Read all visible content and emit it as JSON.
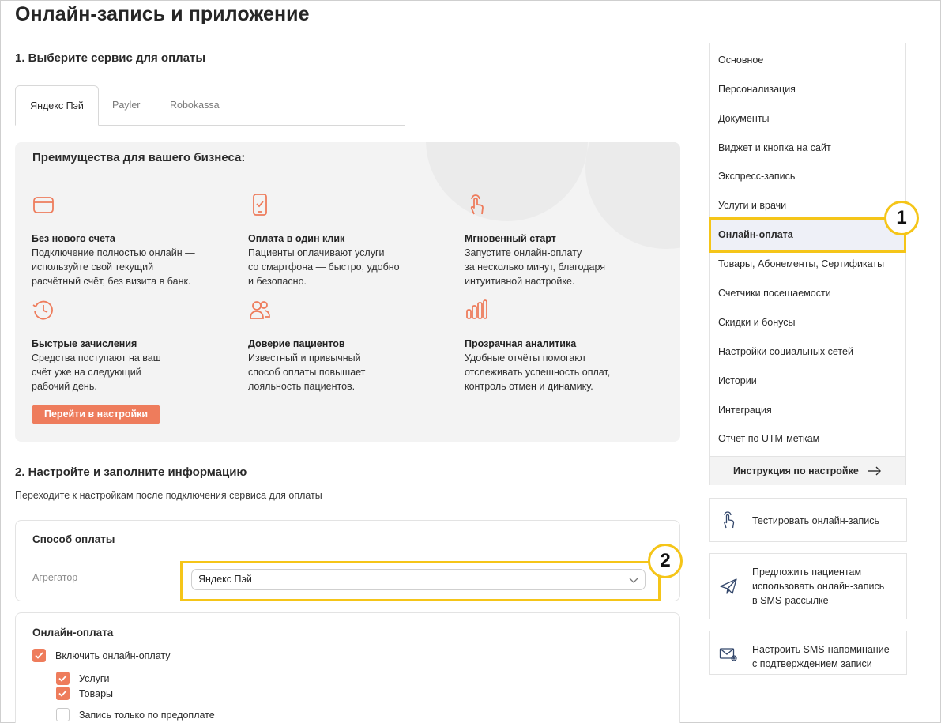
{
  "page": {
    "title": "Онлайн-запись и приложение"
  },
  "step1": {
    "title": "1. Выберите сервис для оплаты",
    "tabs": [
      {
        "label": "Яндекс Пэй",
        "active": true
      },
      {
        "label": "Payler",
        "active": false
      },
      {
        "label": "Robokassa",
        "active": false
      }
    ]
  },
  "benefits": {
    "title": "Преимущества для вашего бизнеса:",
    "accent_color": "#ee7c5c",
    "features": [
      {
        "icon": "card-icon",
        "title": "Без нового счета",
        "text": "Подключение полностью онлайн —\nиспользуйте свой текущий\nрасчётный счёт, без визита в банк."
      },
      {
        "icon": "smartphone-check-icon",
        "title": "Оплата в один клик",
        "text": "Пациенты оплачивают услуги\nсо смартфона — быстро, удобно\nи безопасно."
      },
      {
        "icon": "tap-hand-icon",
        "title": "Мгновенный старт",
        "text": "Запустите онлайн-оплату\nза несколько минут, благодаря\nинтуитивной настройке."
      },
      {
        "icon": "clock-icon",
        "title": "Быстрые зачисления",
        "text": "Средства поступают на ваш\nсчёт уже на следующий\nрабочий день."
      },
      {
        "icon": "users-icon",
        "title": "Доверие пациентов",
        "text": "Известный и привычный\nспособ оплаты повышает\nлояльность пациентов."
      },
      {
        "icon": "bar-chart-icon",
        "title": "Прозрачная аналитика",
        "text": "Удобные отчёты помогают\nотслеживать успешность оплат,\nконтроль отмен и динамику."
      }
    ],
    "button_label": "Перейти в настройки"
  },
  "step2": {
    "title": "2. Настройте и заполните информацию",
    "subtitle": "Переходите к настройкам после подключения сервиса для оплаты"
  },
  "payment_method": {
    "title": "Способ оплаты",
    "aggregator_label": "Агрегатор",
    "aggregator_value": "Яндекс Пэй"
  },
  "online_payment": {
    "title": "Онлайн-оплата",
    "options": [
      {
        "label": "Включить онлайн-оплату",
        "checked": true
      },
      {
        "label": "Услуги",
        "checked": true
      },
      {
        "label": "Товары",
        "checked": true
      },
      {
        "label": "Запись только по предоплате",
        "checked": false
      }
    ]
  },
  "sidebar": {
    "items": [
      {
        "label": "Основное"
      },
      {
        "label": "Персонализация"
      },
      {
        "label": "Документы"
      },
      {
        "label": "Виджет и кнопка на сайт"
      },
      {
        "label": "Экспресс-запись"
      },
      {
        "label": "Услуги и врачи"
      },
      {
        "label": "Онлайн-оплата",
        "active": true
      },
      {
        "label": "Товары, Абонементы, Сертификаты"
      },
      {
        "label": "Счетчики посещаемости"
      },
      {
        "label": "Скидки и бонусы"
      },
      {
        "label": "Настройки социальных сетей"
      },
      {
        "label": "Истории"
      },
      {
        "label": "Интеграция"
      },
      {
        "label": "Отчет по UTM-меткам"
      }
    ],
    "footer_link": "Инструкция по настройке"
  },
  "actions": [
    {
      "icon": "touch-hand-icon",
      "label": "Тестировать онлайн-запись"
    },
    {
      "icon": "paper-plane-icon",
      "label": "Предложить пациентам\nиспользовать онлайн-запись\nв SMS-рассылке"
    },
    {
      "icon": "envelope-gear-icon",
      "label": "Настроить SMS-напоминание\nс подтверждением записи"
    }
  ],
  "annotations": {
    "badge1": "1",
    "badge2": "2",
    "highlight_color": "#f5c518"
  }
}
